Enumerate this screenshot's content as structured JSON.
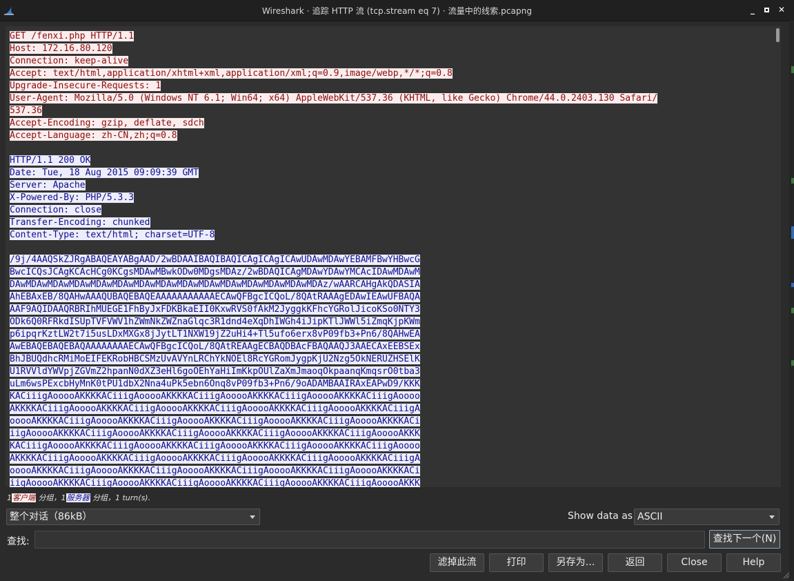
{
  "window": {
    "title": "Wireshark · 追踪 HTTP 流 (tcp.stream eq 7) · 流量中的线索.pcapng"
  },
  "stream": {
    "client_lines": [
      "GET /fenxi.php HTTP/1.1",
      "Host: 172.16.80.120",
      "Connection: keep-alive",
      "Accept: text/html,application/xhtml+xml,application/xml;q=0.9,image/webp,*/*;q=0.8",
      "Upgrade-Insecure-Requests: 1",
      "User-Agent: Mozilla/5.0 (Windows NT 6.1; Win64; x64) AppleWebKit/537.36 (KHTML, like Gecko) Chrome/44.0.2403.130 Safari/",
      "537.36",
      "Accept-Encoding: gzip, deflate, sdch",
      "Accept-Language: zh-CN,zh;q=0.8"
    ],
    "server_header_lines": [
      "HTTP/1.1 200 OK",
      "Date: Tue, 18 Aug 2015 09:09:39 GMT",
      "Server: Apache",
      "X-Powered-By: PHP/5.3.3",
      "Connection: close",
      "Transfer-Encoding: chunked",
      "Content-Type: text/html; charset=UTF-8"
    ],
    "server_body_lines": [
      "/9j/4AAQSkZJRgABAQEAYABgAAD/2wBDAAIBAQIBAQICAgICAgICAwUDAwMDAwYEBAMFBwYHBwcG",
      "BwcICQsJCAgKCAcHCg0KCgsMDAwMBwkODw0MDgsMDAz/2wBDAQICAgMDAwYDAwYMCAcIDAwMDAwM",
      "DAwMDAwMDAwMDAwMDAwMDAwMDAwMDAwMDAwMDAwMDAwMDAwMDAwMDAwMDAz/wAARCAHgAkQDASIA",
      "AhEBAxEB/8QAHwAAAQUBAQEBAQEAAAAAAAAAAAECAwQFBgcICQoL/8QAtRAAAgEDAwIEAwUFBAQA",
      "AAF9AQIDAAQRBRIhMUEGE1FhByJxFDKBkaEII0KxwRVS0fAkM2JyggkKFhcYGRolJicoKSo0NTY3",
      "ODk6Q0RFRkdISUpTVFVWV1hZWmNkZWZnaGlqc3R1dnd4eXqDhIWGh4iJipKTlJWWl5iZmqKjpKWm",
      "p6ipqrKztLW2t7i5usLDxMXGx8jJytLT1NXW19jZ2uHi4+Tl5ufo6erx8vP09fb3+Pn6/8QAHwEA",
      "AwEBAQEBAQEBAQAAAAAAAAECAwQFBgcICQoL/8QAtREAAgECBAQDBAcFBAQAAQJ3AAECAxEEBSEx",
      "BhJBUQdhcRMiMoEIFEKRobHBCSMzUvAVYnLRChYkNOEl8RcYGRomJygpKjU2Nzg5OkNERUZHSElK",
      "U1RVVldYWVpjZGVmZ2hpanN0dXZ3eHl6goOEhYaHiImKkpOUlZaXmJmaoqOkpaanqKmqsrO0tba3",
      "uLm6wsPExcbHyMnK0tPU1dbX2Nna4uPk5ebn6Onq8vP09fb3+Pn6/9oADAMBAAIRAxEAPwD9/KKK",
      "KACiiigAooooAKKKKACiiigAooooAKKKKACiiigAooooAKKKKACiiigAooooAKKKKACiiigAoooo",
      "AKKKKACiiigAooooAKKKKACiiigAooooAKKKKACiiigAooooAKKKKACiiigAooooAKKKKACiiigA",
      "ooooAKKKKACiiigAooooAKKKKACiiigAooooAKKKKACiiigAooooAKKKKACiiigAooooAKKKKACi",
      "iigAooooAKKKKACiiigAooooAKKKKACiiigAooooAKKKKACiiigAooooAKKKKACiiigAooooAKKK",
      "KACiiigAooooAKKKKACiiigAooooAKKKKACiiigAooooAKKKKACiiigAooooAKKKKACiiigAoooo",
      "AKKKKACiiigAooooAKKKKACiiigAooooAKKKKACiiigAooooAKKKKACiiigAooooAKKKKACiiigA",
      "ooooAKKKKACiiigAooooAKKKKACiiigAooooAKKKKACiiigAooooAKKKKACiiigAooooAKKKKACi",
      "iigAooooAKKKKACiiigAooooAKKKKACiiigAooooAKKKKACiiigAooooAKKKKACiiigAooooAKKK"
    ]
  },
  "summary": {
    "client_count": "1",
    "client_label": "客户端",
    "sep1": " 分组，",
    "server_count": "1",
    "server_label": "服务器",
    "sep2": " 分组，",
    "turns": "1 turn(s)."
  },
  "controls": {
    "conversation_select": "整个对话（86kB）",
    "show_data_as_label": "Show data as",
    "show_data_as_value": "ASCII",
    "find_label": "查找:",
    "find_value": "",
    "find_next_button": "查找下一个(N)",
    "filter_out_button": "滤掉此流",
    "print_button": "打印",
    "save_as_button": "另存为…",
    "back_button": "返回",
    "close_button": "Close",
    "help_button": "Help"
  },
  "colors": {
    "client_bg": "#fbeded",
    "client_fg": "#8b0d0d",
    "server_bg": "#ededfb",
    "server_fg": "#0d0d8b"
  }
}
